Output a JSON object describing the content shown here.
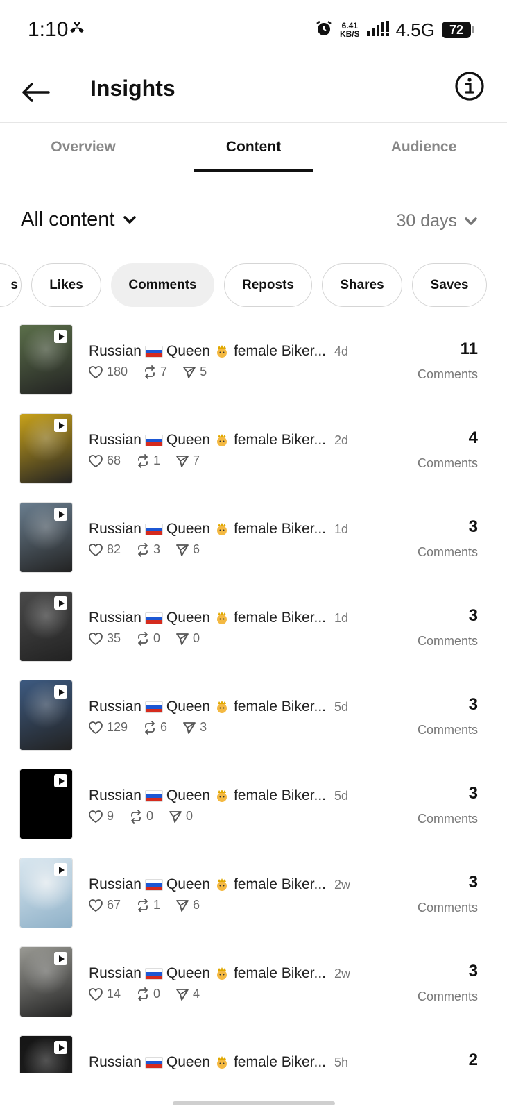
{
  "status_bar": {
    "time": "1:10",
    "speed_value": "6.41",
    "speed_unit": "KB/S",
    "network": "4.5G",
    "battery": "72"
  },
  "header": {
    "title": "Insights"
  },
  "tabs": [
    {
      "label": "Overview",
      "active": false
    },
    {
      "label": "Content",
      "active": true
    },
    {
      "label": "Audience",
      "active": false
    }
  ],
  "filters": {
    "content_type": "All content",
    "period": "30 days"
  },
  "chips": [
    {
      "label": "s",
      "active": false
    },
    {
      "label": "Likes",
      "active": false
    },
    {
      "label": "Comments",
      "active": true
    },
    {
      "label": "Reposts",
      "active": false
    },
    {
      "label": "Shares",
      "active": false
    },
    {
      "label": "Saves",
      "active": false
    }
  ],
  "posts": [
    {
      "caption_a": "Russian",
      "caption_b": "Queen",
      "caption_c": "female Biker...",
      "age": "4d",
      "likes": "180",
      "reposts": "7",
      "shares": "5",
      "count": "11",
      "count_label": "Comments",
      "thumb": "#5b6f4a"
    },
    {
      "caption_a": "Russian",
      "caption_b": "Queen",
      "caption_c": "female Biker...",
      "age": "2d",
      "likes": "68",
      "reposts": "1",
      "shares": "7",
      "count": "4",
      "count_label": "Comments",
      "thumb": "#c9a21a"
    },
    {
      "caption_a": "Russian",
      "caption_b": "Queen",
      "caption_c": "female Biker...",
      "age": "1d",
      "likes": "82",
      "reposts": "3",
      "shares": "6",
      "count": "3",
      "count_label": "Comments",
      "thumb": "#6a7e8f"
    },
    {
      "caption_a": "Russian",
      "caption_b": "Queen",
      "caption_c": "female Biker...",
      "age": "1d",
      "likes": "35",
      "reposts": "0",
      "shares": "0",
      "count": "3",
      "count_label": "Comments",
      "thumb": "#4a4a4a"
    },
    {
      "caption_a": "Russian",
      "caption_b": "Queen",
      "caption_c": "female Biker...",
      "age": "5d",
      "likes": "129",
      "reposts": "6",
      "shares": "3",
      "count": "3",
      "count_label": "Comments",
      "thumb": "#3d5a80"
    },
    {
      "caption_a": "Russian",
      "caption_b": "Queen",
      "caption_c": "female Biker...",
      "age": "5d",
      "likes": "9",
      "reposts": "0",
      "shares": "0",
      "count": "3",
      "count_label": "Comments",
      "thumb": "#000000"
    },
    {
      "caption_a": "Russian",
      "caption_b": "Queen",
      "caption_c": "female Biker...",
      "age": "2w",
      "likes": "67",
      "reposts": "1",
      "shares": "6",
      "count": "3",
      "count_label": "Comments",
      "thumb": "#c7dbe8"
    },
    {
      "caption_a": "Russian",
      "caption_b": "Queen",
      "caption_c": "female Biker...",
      "age": "2w",
      "likes": "14",
      "reposts": "0",
      "shares": "4",
      "count": "3",
      "count_label": "Comments",
      "thumb": "#9a9a94"
    },
    {
      "caption_a": "Russian",
      "caption_b": "Queen",
      "caption_c": "female Biker...",
      "age": "5h",
      "likes": "",
      "reposts": "",
      "shares": "",
      "count": "2",
      "count_label": "",
      "thumb": "#151515"
    }
  ]
}
